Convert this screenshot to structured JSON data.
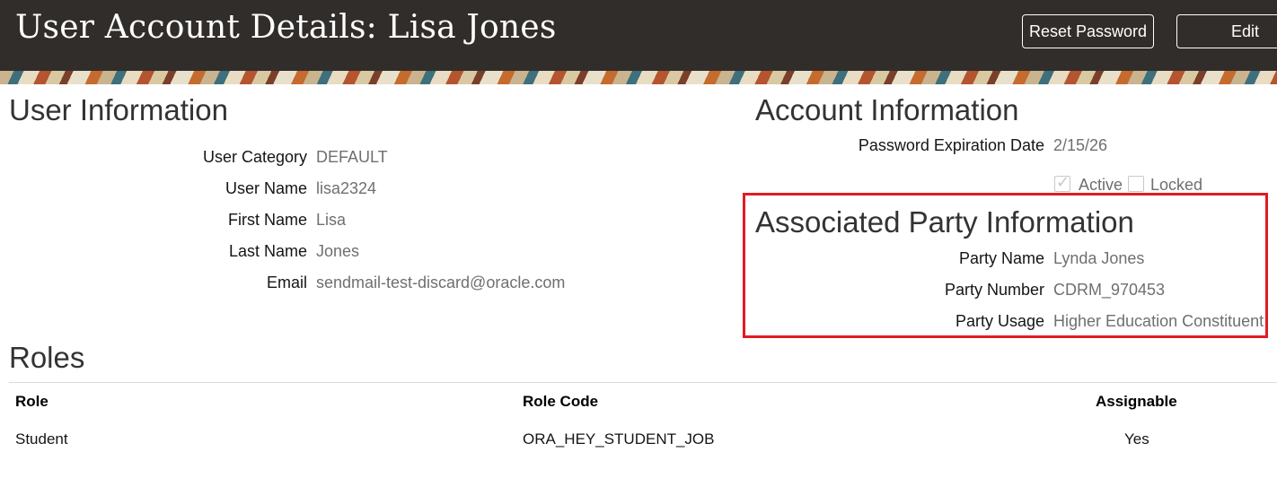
{
  "header": {
    "title": "User Account Details: Lisa Jones",
    "reset_password_label": "Reset Password",
    "edit_label": "Edit"
  },
  "user_information": {
    "title": "User Information",
    "fields": {
      "user_category": {
        "label": "User Category",
        "value": "DEFAULT"
      },
      "user_name": {
        "label": "User Name",
        "value": "lisa2324"
      },
      "first_name": {
        "label": "First Name",
        "value": "Lisa"
      },
      "last_name": {
        "label": "Last Name",
        "value": "Jones"
      },
      "email": {
        "label": "Email",
        "value": "sendmail-test-discard@oracle.com"
      }
    }
  },
  "account_information": {
    "title": "Account Information",
    "password_expiration": {
      "label": "Password Expiration Date",
      "value": "2/15/26"
    },
    "active": {
      "label": "Active",
      "checked": true
    },
    "locked": {
      "label": "Locked",
      "checked": false
    }
  },
  "associated_party": {
    "title": "Associated Party Information",
    "fields": {
      "party_name": {
        "label": "Party Name",
        "value": "Lynda Jones"
      },
      "party_number": {
        "label": "Party Number",
        "value": "CDRM_970453"
      },
      "party_usage": {
        "label": "Party Usage",
        "value": "Higher Education Constituent"
      }
    },
    "highlight_color": "#e21b23"
  },
  "roles": {
    "title": "Roles",
    "columns": {
      "role": "Role",
      "role_code": "Role Code",
      "assignable": "Assignable"
    },
    "rows": [
      {
        "role": "Student",
        "role_code": "ORA_HEY_STUDENT_JOB",
        "assignable": "Yes"
      }
    ]
  },
  "colors": {
    "header_bg": "#312d2a",
    "label_text": "#161513",
    "value_text": "#6f6f6f"
  }
}
